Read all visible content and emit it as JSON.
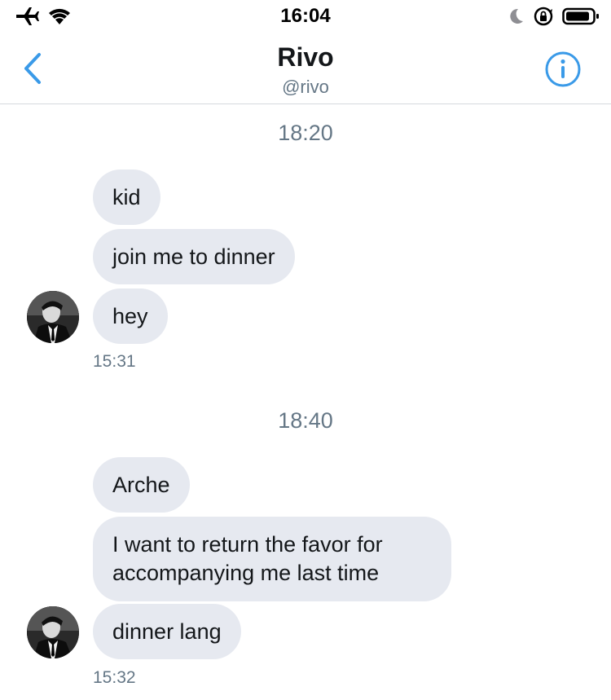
{
  "status_bar": {
    "time": "16:04",
    "icons": [
      "airplane-icon",
      "wifi-icon",
      "moon-icon",
      "orientation-lock-icon",
      "battery-icon"
    ]
  },
  "header": {
    "title": "Rivo",
    "handle": "@rivo",
    "back_icon": "chevron-left-icon",
    "info_icon": "info-icon",
    "accent": "#3a9ae8"
  },
  "conversation": {
    "groups": [
      {
        "timestamp": "18:20",
        "messages": [
          "kid",
          "join me to dinner",
          "hey"
        ],
        "sent_time": "15:31"
      },
      {
        "timestamp": "18:40",
        "messages": [
          "Arche",
          "I want to return the favor for accompanying me last time",
          "dinner lang"
        ],
        "sent_time": "15:32"
      }
    ]
  },
  "colors": {
    "bubble": "#e6e9f0",
    "secondary_text": "#657786",
    "divider": "#d5d9dd"
  }
}
